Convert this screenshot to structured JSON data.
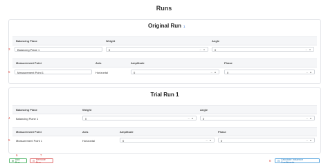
{
  "page": {
    "title": "Runs"
  },
  "runs": [
    {
      "title": "Original Run",
      "count": "1",
      "planes_header": {
        "plane": "Balancing Plane",
        "weight": "Weight",
        "angle": "Angle"
      },
      "plane_row": {
        "index": "3",
        "plane": "Balancing Plane 1",
        "weight": "0",
        "angle": "0"
      },
      "points_header": {
        "point": "Measurement Point",
        "axis": "Axis",
        "amplitude": "Amplitude",
        "phase": "Phase"
      },
      "point_row": {
        "index": "5",
        "point": "Measurement Point 1",
        "axis": "Horizontal",
        "amplitude": "0",
        "phase": "0"
      }
    },
    {
      "title": "Trial Run 1",
      "planes_header": {
        "plane": "Balancing Plane",
        "weight": "Weight",
        "angle": "Angle"
      },
      "plane_row": {
        "index": "4",
        "plane": "Balancing Plane 1",
        "weight": "0",
        "angle": "0"
      },
      "points_header": {
        "point": "Measurement Point",
        "axis": "Axis",
        "amplitude": "Amplitude",
        "phase": "Phase"
      },
      "point_row": {
        "index": "5",
        "point": "Measurement Point 1",
        "axis": "Horizontal",
        "amplitude": "0",
        "phase": "0"
      }
    }
  ],
  "footer": {
    "add_label": "Add Run",
    "remove_label": "Remove Run",
    "calc_label": "Calculate Influence Coefficients",
    "marker_add": "6",
    "marker_remove": "7",
    "marker_calc": "8"
  }
}
